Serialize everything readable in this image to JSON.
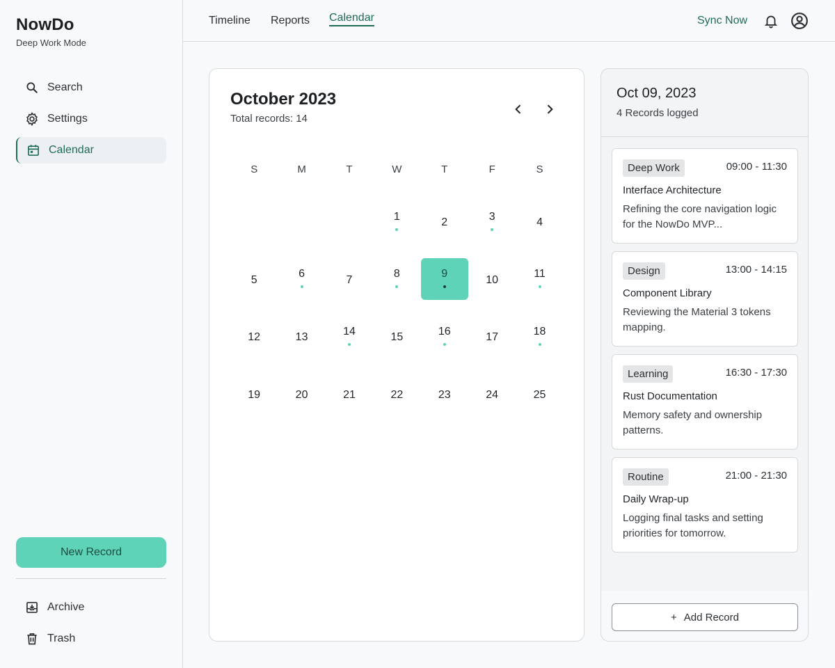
{
  "app": {
    "name": "NowDo",
    "subtitle": "Deep Work Mode"
  },
  "sidebar": {
    "items": [
      {
        "label": "Search",
        "icon": "search-icon"
      },
      {
        "label": "Settings",
        "icon": "gear-icon"
      },
      {
        "label": "Calendar",
        "icon": "calendar-icon",
        "active": true
      }
    ],
    "new_record_label": "New Record",
    "bottom_items": [
      {
        "label": "Archive",
        "icon": "archive-icon"
      },
      {
        "label": "Trash",
        "icon": "trash-icon"
      }
    ]
  },
  "topbar": {
    "tabs": [
      {
        "label": "Timeline"
      },
      {
        "label": "Reports"
      },
      {
        "label": "Calendar",
        "active": true
      }
    ],
    "sync_label": "Sync Now",
    "icons": [
      "bell-icon",
      "account-circle-icon"
    ]
  },
  "calendar": {
    "month_title": "October 2023",
    "total_label": "Total records: 14",
    "weekdays": [
      "S",
      "M",
      "T",
      "W",
      "T",
      "F",
      "S"
    ],
    "weeks": [
      [
        null,
        null,
        null,
        {
          "day": "1",
          "dot": true
        },
        {
          "day": "2"
        },
        {
          "day": "3",
          "dot": true
        },
        {
          "day": "4"
        }
      ],
      [
        {
          "day": "5"
        },
        {
          "day": "6",
          "dot": true
        },
        {
          "day": "7"
        },
        {
          "day": "8",
          "dot": true
        },
        {
          "day": "9",
          "dot": true,
          "selected": true
        },
        {
          "day": "10"
        },
        {
          "day": "11",
          "dot": true
        }
      ],
      [
        {
          "day": "12"
        },
        {
          "day": "13"
        },
        {
          "day": "14",
          "dot": true
        },
        {
          "day": "15"
        },
        {
          "day": "16",
          "dot": true
        },
        {
          "day": "17"
        },
        {
          "day": "18",
          "dot": true
        }
      ],
      [
        {
          "day": "19"
        },
        {
          "day": "20"
        },
        {
          "day": "21"
        },
        {
          "day": "22"
        },
        {
          "day": "23"
        },
        {
          "day": "24"
        },
        {
          "day": "25"
        }
      ]
    ]
  },
  "panel": {
    "date": "Oct 09, 2023",
    "count_label": "4 Records logged",
    "records": [
      {
        "tag": "Deep Work",
        "time": "09:00 - 11:30",
        "title": "Interface Architecture",
        "desc": "Refining the core navigation logic for the NowDo MVP..."
      },
      {
        "tag": "Design",
        "time": "13:00 - 14:15",
        "title": "Component Library",
        "desc": "Reviewing the Material 3 tokens mapping."
      },
      {
        "tag": "Learning",
        "time": "16:30 - 17:30",
        "title": "Rust Documentation",
        "desc": "Memory safety and ownership patterns."
      },
      {
        "tag": "Routine",
        "time": "21:00 - 21:30",
        "title": "Daily Wrap-up",
        "desc": "Logging final tasks and setting priorities for tomorrow."
      }
    ],
    "add_label": "Add Record",
    "add_plus": "+"
  },
  "colors": {
    "accent": "#5fd3b8",
    "primary_text": "#1f6b57"
  }
}
